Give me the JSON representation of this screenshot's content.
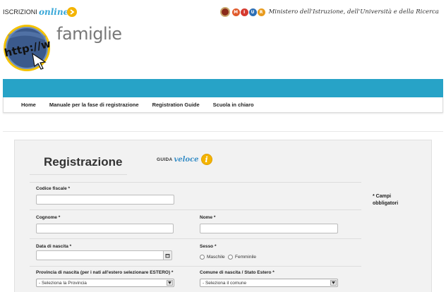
{
  "header": {
    "brand_prefix": "ISCRIZIONI",
    "brand_suffix": "online",
    "ministry_letters": [
      "M",
      "I",
      "U",
      "R"
    ],
    "ministry_colors": [
      "#e05a2b",
      "#d63a2f",
      "#2d6fb5",
      "#e89b1e"
    ],
    "ministry_text": "Ministero dell'Istruzione, dell'Università e della Ricerca",
    "logo_text": "http://w",
    "site_name": "famiglie"
  },
  "nav": {
    "items": [
      "Home",
      "Manuale per la fase di registrazione",
      "Registration Guide",
      "Scuola in chiaro"
    ]
  },
  "form": {
    "title": "Registrazione",
    "guida_small": "GUIDA",
    "guida_veloce": "veloce",
    "guida_icon": "i",
    "required_note": "* Campi obbligatori",
    "fields": {
      "codice_fiscale": {
        "label": "Codice fiscale *",
        "value": ""
      },
      "cognome": {
        "label": "Cognome *",
        "value": ""
      },
      "nome": {
        "label": "Nome *",
        "value": ""
      },
      "data_nascita": {
        "label": "Data di nascita *",
        "value": ""
      },
      "sesso": {
        "label": "Sesso *",
        "options": [
          "Maschile",
          "Femminile"
        ]
      },
      "provincia": {
        "label": "Provincia di nascita (per i nati all'estero selezionare ESTERO) *",
        "selected": "- Seleziona la Provincia"
      },
      "comune": {
        "label": "Comune di nascita / Stato Estero *",
        "selected": "- Seleziona il comune"
      }
    }
  },
  "colors": {
    "accent_bar": "#27a3c7",
    "brand_blue": "#3aa8d8",
    "highlight_yellow": "#f4b400"
  }
}
